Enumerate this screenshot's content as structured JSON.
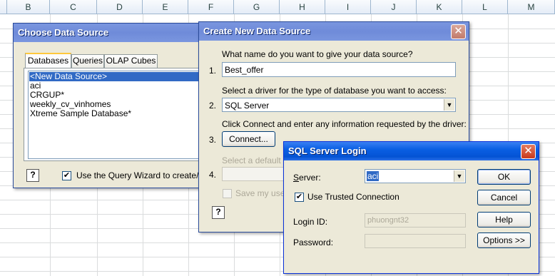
{
  "columns": [
    "B",
    "C",
    "D",
    "E",
    "F",
    "G",
    "H",
    "I",
    "J",
    "K",
    "L",
    "M"
  ],
  "choose_dialog": {
    "title": "Choose Data Source",
    "tabs": [
      "Databases",
      "Queries",
      "OLAP Cubes"
    ],
    "sources": [
      "<New Data Source>",
      "aci",
      "CRGUP*",
      "weekly_cv_vinhomes",
      "Xtreme Sample Database*"
    ],
    "query_wizard_label": "Use the Query Wizard to create/edit"
  },
  "create_dialog": {
    "title": "Create New Data Source",
    "q1": "What name do you want to give your data source?",
    "step1": "1.",
    "name_value": "Best_offer",
    "q2": "Select a driver for the type of database you want to access:",
    "step2": "2.",
    "driver_value": "SQL Server",
    "q3": "Click Connect and enter any information requested by the driver:",
    "step3": "3.",
    "connect_label": "Connect...",
    "q4": "Select a default ta",
    "step4": "4.",
    "save_label": "Save my user I"
  },
  "login_dialog": {
    "title": "SQL Server Login",
    "server_label": "Server:",
    "server_value": "aci",
    "trusted_label": "Use Trusted Connection",
    "login_label": "Login ID:",
    "login_value": "phuongnt32",
    "password_label": "Password:",
    "ok_label": "OK",
    "cancel_label": "Cancel",
    "help_label": "Help",
    "options_label": "Options >>"
  },
  "icons": {
    "help": "?",
    "close": "✕",
    "check": "✔",
    "arrow": "▼"
  }
}
